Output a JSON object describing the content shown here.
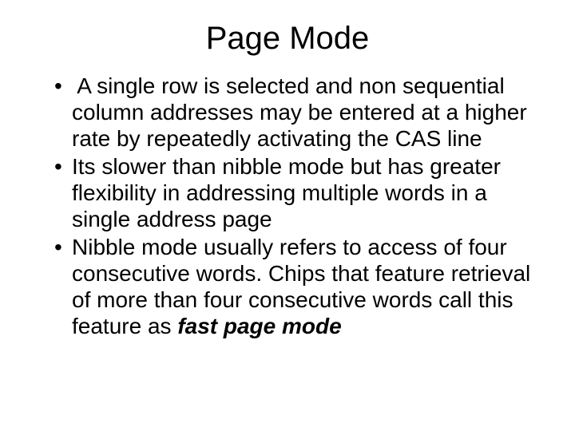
{
  "title": "Page Mode",
  "bullets": [
    " A single row is selected and non sequential column addresses may be entered at a higher rate by repeatedly activating the CAS line",
    "Its slower than nibble mode but has greater flexibility in addressing multiple words in a single address page",
    "Nibble mode usually refers to access of four consecutive words. Chips that feature retrieval of more than four consecutive words call this feature as "
  ],
  "emphasis": "fast page mode"
}
